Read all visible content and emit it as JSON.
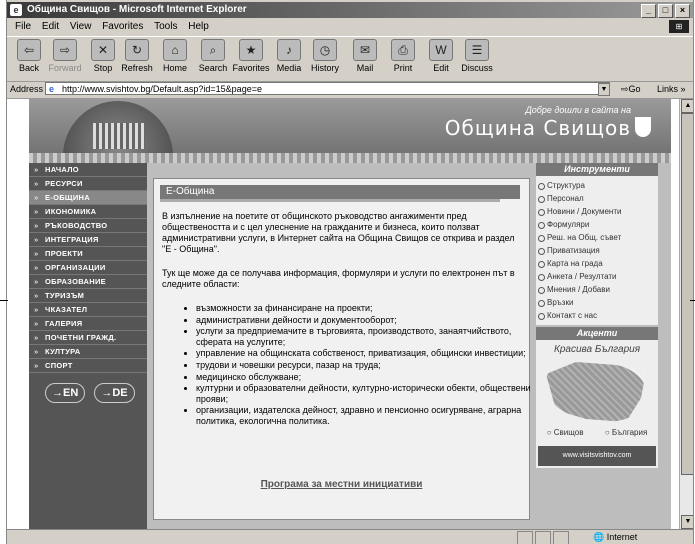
{
  "window": {
    "title": "Община Свищов - Microsoft Internet Explorer"
  },
  "menu": [
    "File",
    "Edit",
    "View",
    "Favorites",
    "Tools",
    "Help"
  ],
  "toolbar": [
    {
      "label": "Back",
      "icon": "back-arrow-icon",
      "glyph": "⇦"
    },
    {
      "label": "Forward",
      "icon": "forward-arrow-icon",
      "glyph": "⇨"
    },
    {
      "label": "Stop",
      "icon": "stop-icon",
      "glyph": "✕"
    },
    {
      "label": "Refresh",
      "icon": "refresh-icon",
      "glyph": "↻"
    },
    {
      "label": "Home",
      "icon": "home-icon",
      "glyph": "⌂"
    },
    {
      "label": "Search",
      "icon": "search-icon",
      "glyph": "⌕"
    },
    {
      "label": "Favorites",
      "icon": "favorites-icon",
      "glyph": "★"
    },
    {
      "label": "Media",
      "icon": "media-icon",
      "glyph": "♪"
    },
    {
      "label": "History",
      "icon": "history-icon",
      "glyph": "◷"
    },
    {
      "label": "Mail",
      "icon": "mail-icon",
      "glyph": "✉"
    },
    {
      "label": "Print",
      "icon": "print-icon",
      "glyph": "⎙"
    },
    {
      "label": "Edit",
      "icon": "edit-icon",
      "glyph": "W"
    },
    {
      "label": "Discuss",
      "icon": "discuss-icon",
      "glyph": "☰"
    }
  ],
  "address": {
    "label": "Address",
    "url": "http://www.svishtov.bg/Default.asp?id=15&page=e",
    "go": "Go",
    "links": "Links »"
  },
  "site": {
    "welcome": "Добре дошли в сайта на",
    "title": "Община Свищов"
  },
  "nav": [
    "НАЧАЛО",
    "РЕСУРСИ",
    "Е-ОБЩИНА",
    "ИКОНОМИКА",
    "РЪКОВОДСТВО",
    "ИНТЕГРАЦИЯ",
    "ПРОЕКТИ",
    "ОРГАНИЗАЦИИ",
    "ОБРАЗОВАНИЕ",
    "ТУРИЗЪМ",
    "ЧКАЗАТЕЛ",
    "ГАЛЕРИЯ",
    "ПОЧЕТНИ ГРАЖД.",
    "КУЛТУРА",
    "СПОРТ"
  ],
  "langs": [
    "→EN",
    "→DE"
  ],
  "content": {
    "title": "Е-Община",
    "para1": "В изпълнение на поетите от общинското ръководство ангажименти пред обществеността и с цел улеснение на гражданите и бизнеса, които ползват административни услуги, в Интернет сайта на Община Свищов се открива и раздел \"Е - Община\".",
    "para2": "Тук ще може да се получава информация, формуляри и услуги по електронен път в следните области:",
    "bullets": [
      "възможности за финансиране на проекти;",
      "административни дейности и документооборот;",
      "услуги за предприемачите в търговията, производството, занаятчийството, сферата на услугите;",
      "управление на общинската собственост, приватизация, общински инвестиции;",
      "трудови и човешки ресурси, пазар на труда;",
      "медицинско обслужване;",
      "културни и образователни дейности, културно-исторически обекти, обществени прояви;",
      "организации, издателска дейност, здравно и пенсионно осигуряване, аграрна политика, екологична политика."
    ],
    "link": "Програма за местни инициативи"
  },
  "right": {
    "tools_header": "Инструменти",
    "tools": [
      "Структура",
      "Персонал",
      "Новини / Документи",
      "Формуляри",
      "Реш. на Общ. съвет",
      "Приватизация",
      "Карта на града",
      "Анкета / Резултати",
      "Мнения / Добави",
      "Връзки",
      "Контакт с нас"
    ],
    "accent_header": "Акценти",
    "map_title": "Красива България",
    "map_links": [
      "Свищов",
      "България"
    ],
    "banner": "www.visitsvishtov.com"
  },
  "status": {
    "zone": "Internet"
  }
}
